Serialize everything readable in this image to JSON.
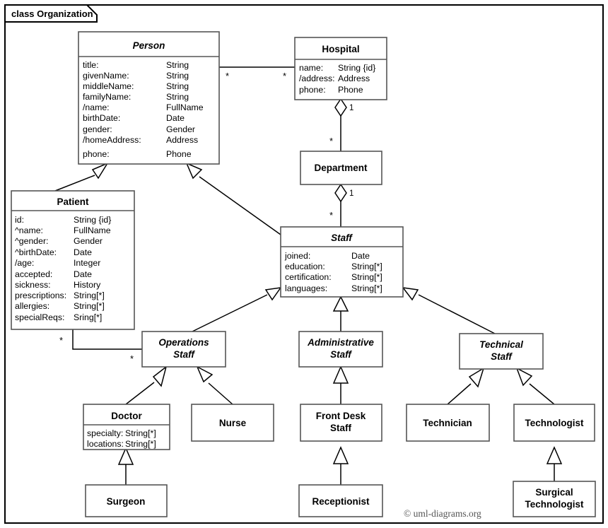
{
  "frame": {
    "tab_label": "class Organization",
    "credit": "© uml-diagrams.org"
  },
  "classes": {
    "person": {
      "name": "Person",
      "abstract": true,
      "attributes": [
        {
          "name": "title:",
          "type": "String"
        },
        {
          "name": "givenName:",
          "type": "String"
        },
        {
          "name": "middleName:",
          "type": "String"
        },
        {
          "name": "familyName:",
          "type": "String"
        },
        {
          "name": "/name:",
          "type": "FullName"
        },
        {
          "name": "birthDate:",
          "type": "Date"
        },
        {
          "name": "gender:",
          "type": "Gender"
        },
        {
          "name": "/homeAddress:",
          "type": "Address"
        },
        {
          "name": "phone:",
          "type": "Phone"
        }
      ]
    },
    "hospital": {
      "name": "Hospital",
      "abstract": false,
      "attributes": [
        {
          "name": "name:",
          "type": "String {id}"
        },
        {
          "name": "/address:",
          "type": "Address"
        },
        {
          "name": "phone:",
          "type": "Phone"
        }
      ]
    },
    "department": {
      "name": "Department",
      "abstract": false,
      "attributes": []
    },
    "patient": {
      "name": "Patient",
      "abstract": false,
      "attributes": [
        {
          "name": "id:",
          "type": "String {id}"
        },
        {
          "name": "^name:",
          "type": "FullName"
        },
        {
          "name": "^gender:",
          "type": "Gender"
        },
        {
          "name": "^birthDate:",
          "type": "Date"
        },
        {
          "name": "/age:",
          "type": "Integer"
        },
        {
          "name": "accepted:",
          "type": "Date"
        },
        {
          "name": "sickness:",
          "type": "History"
        },
        {
          "name": "prescriptions:",
          "type": "String[*]"
        },
        {
          "name": "allergies:",
          "type": "String[*]"
        },
        {
          "name": "specialReqs:",
          "type": "Sring[*]"
        }
      ]
    },
    "staff": {
      "name": "Staff",
      "abstract": true,
      "attributes": [
        {
          "name": "joined:",
          "type": "Date"
        },
        {
          "name": "education:",
          "type": "String[*]"
        },
        {
          "name": "certification:",
          "type": "String[*]"
        },
        {
          "name": "languages:",
          "type": "String[*]"
        }
      ]
    },
    "operations_staff": {
      "name": "Operations Staff",
      "name_line1": "Operations",
      "name_line2": "Staff",
      "abstract": true,
      "attributes": []
    },
    "administrative_staff": {
      "name": "Administrative Staff",
      "name_line1": "Administrative",
      "name_line2": "Staff",
      "abstract": true,
      "attributes": []
    },
    "technical_staff": {
      "name": "Technical Staff",
      "name_line1": "Technical",
      "name_line2": "Staff",
      "abstract": true,
      "attributes": []
    },
    "doctor": {
      "name": "Doctor",
      "abstract": false,
      "attributes": [
        {
          "name": "specialty:",
          "type": "String[*]"
        },
        {
          "name": "locations:",
          "type": "String[*]"
        }
      ]
    },
    "nurse": {
      "name": "Nurse",
      "abstract": false,
      "attributes": []
    },
    "front_desk_staff": {
      "name": "Front Desk Staff",
      "name_line1": "Front Desk",
      "name_line2": "Staff",
      "abstract": false,
      "attributes": []
    },
    "technician": {
      "name": "Technician",
      "abstract": false,
      "attributes": []
    },
    "technologist": {
      "name": "Technologist",
      "abstract": false,
      "attributes": []
    },
    "surgeon": {
      "name": "Surgeon",
      "abstract": false,
      "attributes": []
    },
    "receptionist": {
      "name": "Receptionist",
      "abstract": false,
      "attributes": []
    },
    "surgical_technologist": {
      "name": "Surgical Technologist",
      "name_line1": "Surgical",
      "name_line2": "Technologist",
      "abstract": false,
      "attributes": []
    }
  },
  "multiplicities": {
    "person_hospital_person_end": "*",
    "person_hospital_hospital_end": "*",
    "hospital_department_hospital_end": "1",
    "hospital_department_department_end": "*",
    "department_staff_department_end": "1",
    "department_staff_staff_end": "*",
    "patient_operations_patient_end": "*",
    "patient_operations_operations_end": "*"
  },
  "colors": {
    "background": "#ffffff",
    "box_stroke": "#555555",
    "line": "#000000",
    "text": "#000000",
    "credit_text": "#555555"
  }
}
